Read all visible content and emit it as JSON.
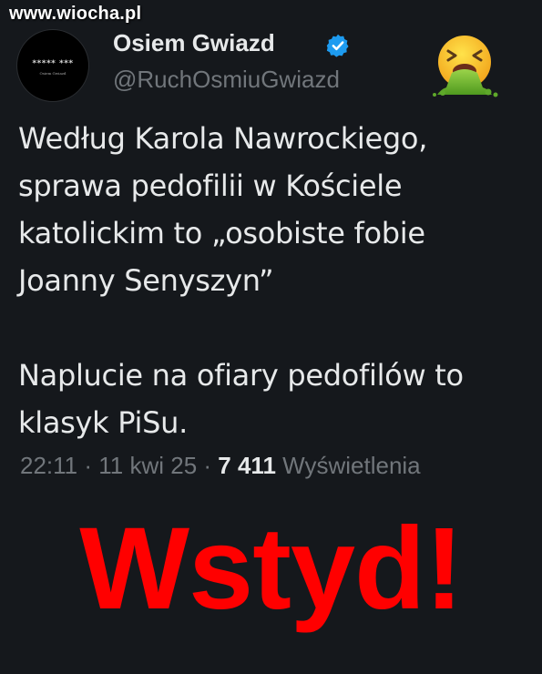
{
  "watermark": "www.wiocha.pl",
  "tweet": {
    "author": {
      "display_name": "Osiem Gwiazd",
      "handle": "@RuchOsmiuGwiazd",
      "verified_icon": "verified-badge-icon",
      "avatar_text": "***** ***",
      "avatar_subtext": "Osiem Gwiazd"
    },
    "reaction_emoji": "nauseated-vomiting-face-icon",
    "body": {
      "paragraph_1": "Według Karola Nawrockiego,\nsprawa pedofilii w Kościele\nkatolickim to „osobiste fobie\nJoanny Senyszyn”",
      "paragraph_2": "Naplucie na ofiary pedofilów to\nklasyk PiSu."
    },
    "meta": {
      "time": "22:11",
      "separator": " · ",
      "date": "11 kwi 25",
      "views_count": "7 411",
      "views_label": "Wyświetlenia"
    }
  },
  "caption": "Wstyd!",
  "colors": {
    "background": "#15181c",
    "primary_text": "#e7e9ea",
    "secondary_text": "#71767b",
    "verified_blue": "#1d9bf0",
    "caption_red": "#ff0000"
  }
}
